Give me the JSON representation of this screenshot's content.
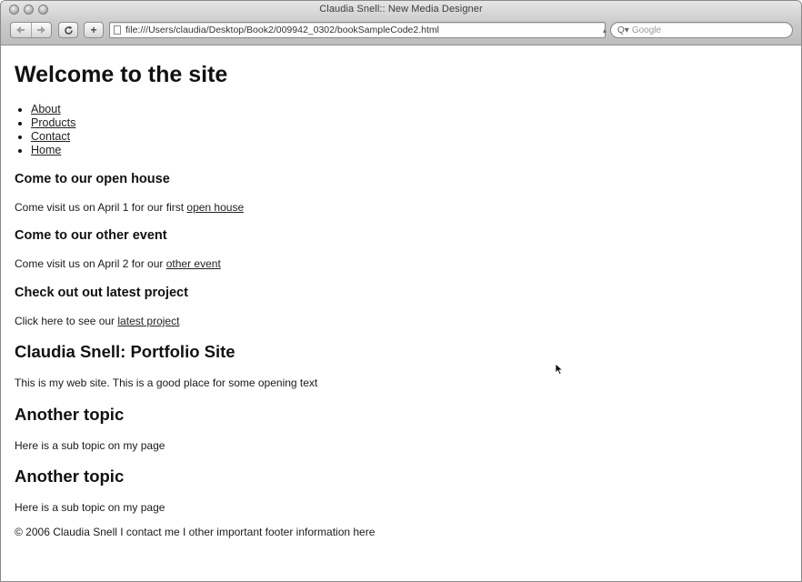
{
  "window": {
    "title": "Claudia Snell:: New Media Designer"
  },
  "toolbar": {
    "back_icon": "back-arrow-icon",
    "forward_icon": "forward-arrow-icon",
    "reload_label": "C",
    "add_bookmark_label": "+",
    "url": "file:///Users/claudia/Desktop/Book2/009942_0302/bookSampleCode2.html",
    "search_placeholder": "Google"
  },
  "page": {
    "heading": "Welcome to the site",
    "nav_items": [
      {
        "label": "About"
      },
      {
        "label": "Products"
      },
      {
        "label": "Contact"
      },
      {
        "label": "Home"
      }
    ],
    "events": [
      {
        "title": "Come to our open house",
        "text": "Come visit us on April 1 for our first ",
        "link": "open house"
      },
      {
        "title": "Come to our other event",
        "text": "Come visit us on April 2 for our ",
        "link": "other event"
      },
      {
        "title": "Check out out latest project",
        "text": "Click here to see our ",
        "link": "latest project"
      }
    ],
    "sections": [
      {
        "title": "Claudia Snell: Portfolio Site",
        "text": "This is my web site. This is a good place for some opening text"
      },
      {
        "title": "Another topic",
        "text": "Here is a sub topic on my page"
      },
      {
        "title": "Another topic",
        "text": "Here is a sub topic on my page"
      }
    ],
    "footer": "© 2006 Claudia Snell I contact me I other important footer information here"
  }
}
